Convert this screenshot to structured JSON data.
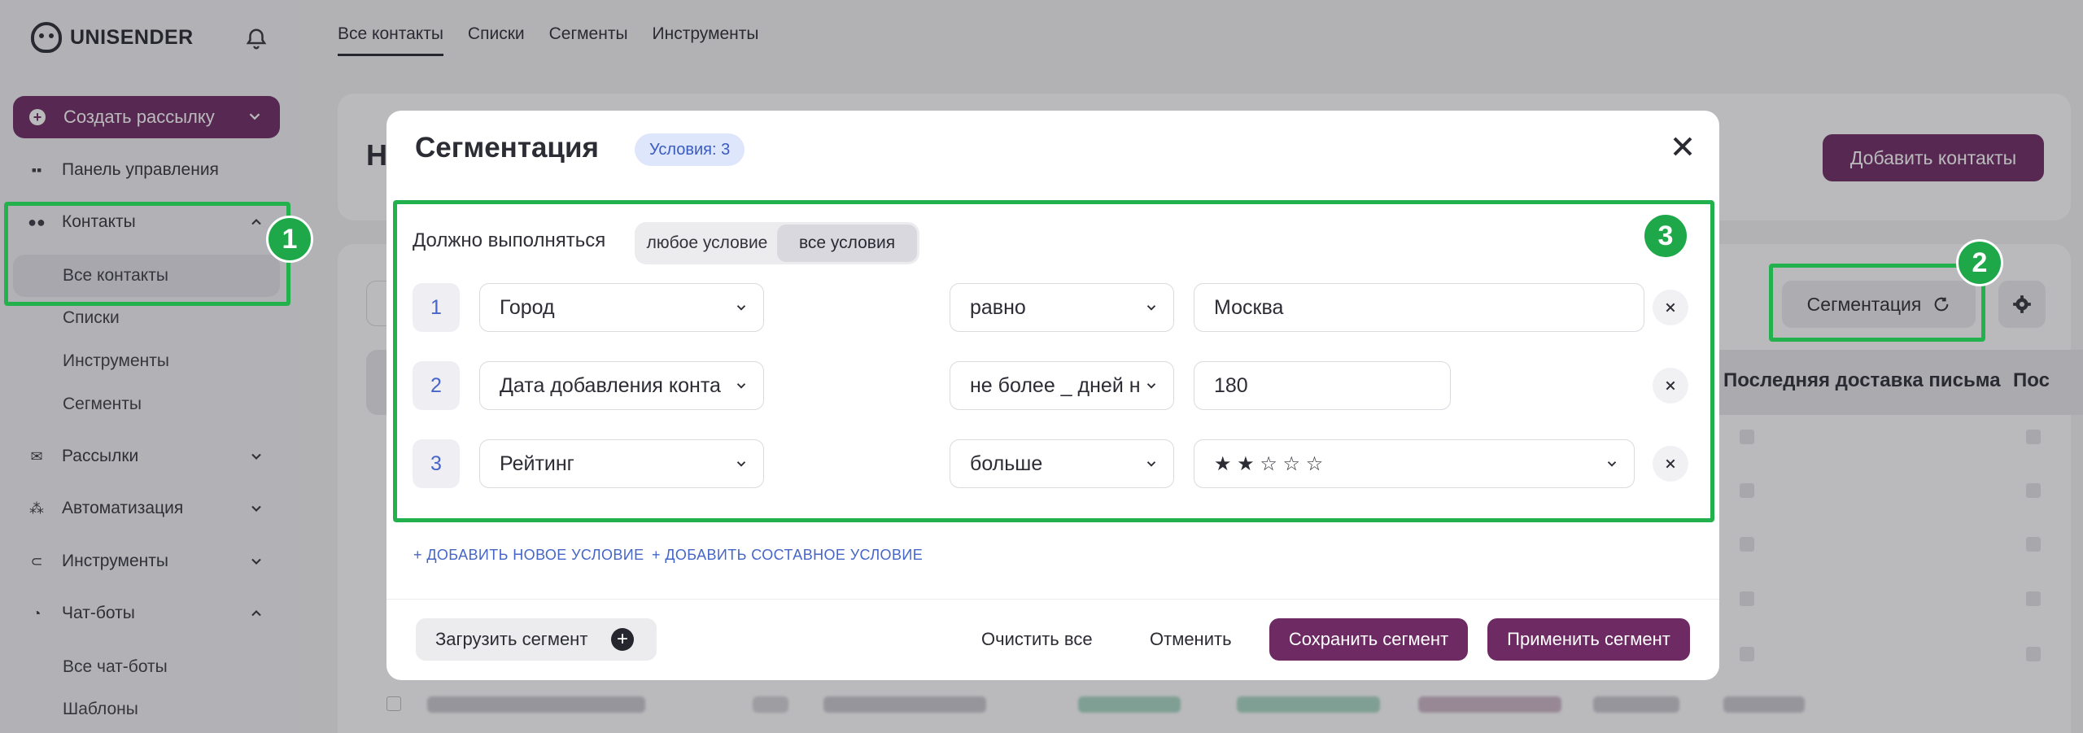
{
  "brand": {
    "name": "UNISENDER"
  },
  "sidebar": {
    "create_label": "Создать рассылку",
    "items": [
      {
        "label": "Панель управления",
        "icon": "dashboard-icon"
      },
      {
        "label": "Контакты",
        "icon": "contacts-icon"
      },
      {
        "label": "Рассылки",
        "icon": "mail-icon"
      },
      {
        "label": "Автоматизация",
        "icon": "automation-icon"
      },
      {
        "label": "Инструменты",
        "icon": "tools-icon"
      },
      {
        "label": "Чат-боты",
        "icon": "chatbot-icon"
      }
    ],
    "contacts_sub": [
      "Все контакты",
      "Списки",
      "Инструменты",
      "Сегменты"
    ],
    "chatbots_sub": [
      "Все чат-боты",
      "Шаблоны"
    ]
  },
  "top_tabs": [
    "Все контакты",
    "Списки",
    "Сегменты",
    "Инструменты"
  ],
  "page": {
    "title_initial": "Н",
    "add_contacts_label": "Добавить контакты",
    "segmentation_label": "Сегментация",
    "columns": [
      "Последняя доставка письма",
      "Пос"
    ]
  },
  "annotations": {
    "badge1": "1",
    "badge2": "2",
    "badge3": "3"
  },
  "modal": {
    "title": "Сегментация",
    "conditions_badge": "Условия: 3",
    "must_label": "Должно выполняться",
    "toggle": {
      "any": "любое условие",
      "all": "все условия",
      "selected": "all"
    },
    "conditions": [
      {
        "num": "1",
        "field": "Город",
        "operator": "равно",
        "value": "Москва"
      },
      {
        "num": "2",
        "field": "Дата добавления конта",
        "operator": "не более _ дней н",
        "value": "180"
      },
      {
        "num": "3",
        "field": "Рейтинг",
        "operator": "больше",
        "value": "★ ★ ☆ ☆ ☆",
        "rating": 2,
        "rating_max": 5
      }
    ],
    "add_condition": "+ ДОБАВИТЬ НОВОЕ УСЛОВИЕ",
    "add_compound": "+ ДОБАВИТЬ СОСТАВНОЕ УСЛОВИЕ",
    "load_segment": "Загрузить сегмент",
    "clear_all": "Очистить все",
    "cancel": "Отменить",
    "save_segment": "Сохранить сегмент",
    "apply_segment": "Применить сегмент"
  },
  "colors": {
    "brand": "#6d2a63",
    "annotation": "#22b14c",
    "link": "#4566c7"
  }
}
